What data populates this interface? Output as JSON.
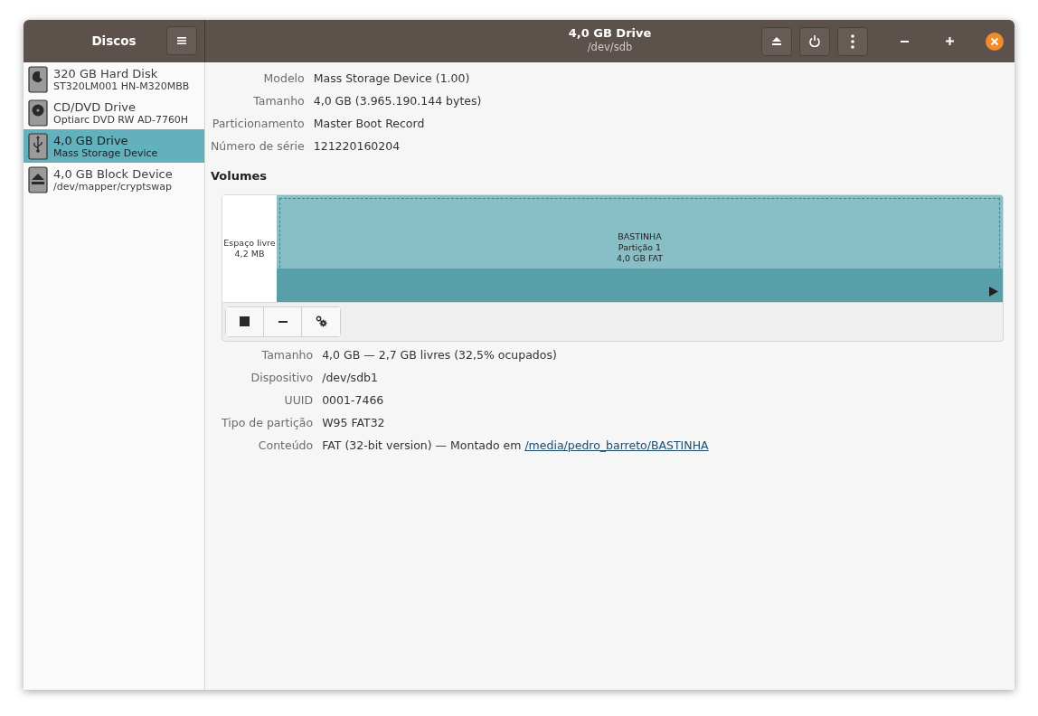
{
  "sidebar": {
    "title": "Discos",
    "items": [
      {
        "kind": "harddisk",
        "name": "320 GB Hard Disk",
        "detail": "ST320LM001 HN-M320MBB",
        "selected": false
      },
      {
        "kind": "optical",
        "name": "CD/DVD Drive",
        "detail": "Optiarc DVD RW AD-7760H",
        "selected": false
      },
      {
        "kind": "usb",
        "name": "4,0 GB Drive",
        "detail": "Mass Storage Device",
        "selected": true
      },
      {
        "kind": "block",
        "name": "4,0 GB Block Device",
        "detail": "/dev/mapper/cryptswap",
        "selected": false
      }
    ]
  },
  "header": {
    "title": "4,0 GB Drive",
    "subtitle": "/dev/sdb"
  },
  "drive_info": [
    {
      "label": "Modelo",
      "value": "Mass Storage Device (1.00)"
    },
    {
      "label": "Tamanho",
      "value": "4,0 GB (3.965.190.144 bytes)"
    },
    {
      "label": "Particionamento",
      "value": "Master Boot Record"
    },
    {
      "label": "Número de série",
      "value": "121220160204"
    }
  ],
  "volumes": {
    "title": "Volumes",
    "segments": [
      {
        "kind": "free",
        "lines": [
          "Espaço livre",
          "4,2 MB"
        ]
      },
      {
        "kind": "partition",
        "lines": [
          "BASTINHA",
          "Partição 1",
          "4,0 GB FAT"
        ],
        "selected": true
      }
    ],
    "info": [
      {
        "label": "Tamanho",
        "value": "4,0 GB — 2,7 GB livres (32,5% ocupados)"
      },
      {
        "label": "Dispositivo",
        "value": "/dev/sdb1"
      },
      {
        "label": "UUID",
        "value": "0001-7466"
      },
      {
        "label": "Tipo de partição",
        "value": "W95 FAT32"
      },
      {
        "label": "Conteúdo",
        "value": "FAT (32-bit version) — Montado em ",
        "link": "/media/pedro_barreto/BASTINHA"
      }
    ]
  }
}
